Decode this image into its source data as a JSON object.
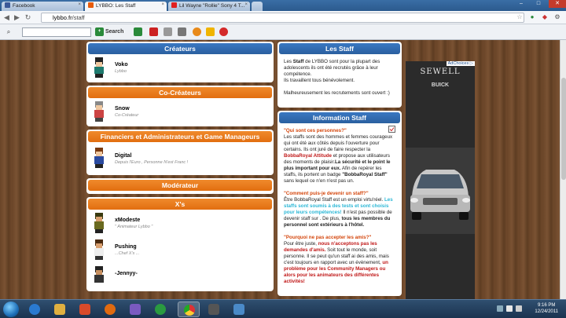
{
  "browser": {
    "tabs": [
      {
        "title": "Facebook",
        "favicon_color": "#3b5998"
      },
      {
        "title": "LYBBO: Les Staff",
        "favicon_color": "#e85c0c"
      },
      {
        "title": "Lil Wayne \"Rollie\" Sony 4 T...",
        "favicon_color": "#e02020"
      }
    ],
    "url_host": "lybbo.fr",
    "url_path": "/staff",
    "search_label": "Search",
    "close_glyph": "×"
  },
  "page": {
    "sections": [
      {
        "title": "Créateurs",
        "color": "blue",
        "members": [
          {
            "name": "Voko",
            "role": "Lybbo"
          }
        ]
      },
      {
        "title": "Co-Créateurs",
        "color": "orange",
        "members": [
          {
            "name": "Snow",
            "role": "Co-Créateur"
          }
        ]
      },
      {
        "title": "Financiers et Administrateurs et Game Manageurs",
        "color": "orange",
        "members": [
          {
            "name": "Digital",
            "role": "Depuis l'Euro , Personne N'est Franc !"
          }
        ]
      },
      {
        "title": "Modérateur",
        "color": "orange",
        "members": []
      },
      {
        "title": "X's",
        "color": "orange",
        "members": [
          {
            "name": "xModeste",
            "role": "\" Animateur Lybbo \""
          },
          {
            "name": "Pushing",
            "role": "...Chef X's ..."
          },
          {
            "name": "-Jennyy-",
            "role": ""
          }
        ]
      }
    ],
    "les_staff": {
      "title": "Les Staff",
      "p1_a": "Les ",
      "p1_b": "Staff",
      "p1_c": " de LYBBO sont pour la plupart des adolescents ils ont été recrutés grâce à leur compétence.",
      "p1_d": "Ils travaillent tous bénévolement.",
      "p2": "Malheureusement les recrutements sont ouvert :)"
    },
    "info_staff": {
      "title": "Information Staff",
      "q1": "\"Qui sont ces personnes?\"",
      "a1_a": "Les staffs sont des hommes et femmes courageux qui ont été aux côtés depuis l'ouverture pour certains. Ils ont juré de faire respecter la ",
      "a1_b": "BobbaRoyal Attitude",
      "a1_c": " et propose aux utilisateurs des moments de plaisir.",
      "a1_d": "La sécurité et le point le plus important pour eux.",
      "a1_e": " Afin de repérer les staffs, ils portent un badge ",
      "a1_f": "\"BobbaRoyal Staff\"",
      "a1_g": " sans lequel ce n'en n'est pas un.",
      "q2": "\"Comment puis-je devenir un staff?\"",
      "a2_a": "Être BobbaRoyal Staff est un emploi virtu'réel. ",
      "a2_b": "Les staffs sont soumis à des tests et sont choisis pour leurs compétences!",
      "a2_c": " Il n'est pas possible de devenir staff sur . De plus, ",
      "a2_d": "tous les membres du personnel sont extérieurs à l'hôtel.",
      "q3": "\"Pourquoi ne pas accepter les amis?\"",
      "a3_a": "Pour être juste, ",
      "a3_b": "nous n'acceptons pas les demandes d'amis.",
      "a3_c": " Soit tout le monde, soit personne. Il se peut qu'un staff ai des amis, mais c'est toujours en rapport avec un évènement, ",
      "a3_d": "un problème pour les Community Managers ou alors pour les animateurs des différentes activités!"
    },
    "ad": {
      "choices": "AdChoices ▷",
      "brand": "SEWELL",
      "make": "BUICK"
    }
  },
  "colors": {
    "blue_header": "#2a5f9f",
    "orange_header": "#e26e10",
    "accent_red": "#c01818",
    "accent_cyan": "#2bb7d6"
  },
  "taskbar": {
    "time": "9:16 PM",
    "date": "12/24/2011"
  }
}
